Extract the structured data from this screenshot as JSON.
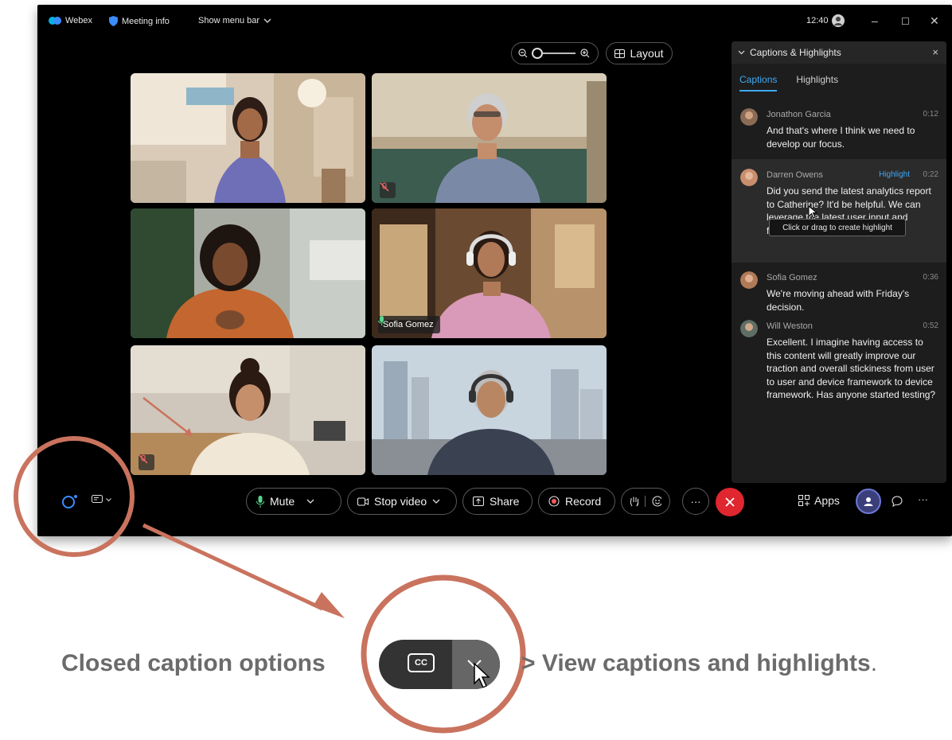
{
  "titlebar": {
    "app": "Webex",
    "meeting_info": "Meeting info",
    "show_menu_bar": "Show menu bar",
    "time": "12:40",
    "minimize": "–",
    "maximize": "☐",
    "close": "✕"
  },
  "toolbar_top": {
    "layout_label": "Layout"
  },
  "participants": [
    {
      "name": "",
      "muted": false
    },
    {
      "name": "",
      "muted": true
    },
    {
      "name": "",
      "muted": false
    },
    {
      "name": "Sofia Gomez",
      "muted": false,
      "active_speaker": true
    },
    {
      "name": "",
      "muted": true
    },
    {
      "name": "",
      "muted": false
    }
  ],
  "captions_panel": {
    "title": "Captions & Highlights",
    "close": "×",
    "tabs": [
      "Captions",
      "Highlights"
    ],
    "active_tab": "Captions",
    "entries": [
      {
        "name": "Jonathon Garcia",
        "time": "0:12",
        "text": "And that's where I think we need to develop our focus."
      },
      {
        "name": "Darren Owens",
        "time": "0:22",
        "badge": "Highlight",
        "text": "Did you send the latest analytics report to Catherine? It'd be helpful. We can leverage the latest user input and feedback"
      },
      {
        "name": "Sofia Gomez",
        "time": "0:36",
        "text": "We're moving ahead with Friday's decision."
      },
      {
        "name": "Will Weston",
        "time": "0:52",
        "text": "Excellent. I imagine having access to this content will greatly improve our traction and overall stickiness from user to user and device framework to device framework. Has anyone started testing?"
      }
    ],
    "tooltip": "Click or drag to create highlight"
  },
  "controls": {
    "mute": "Mute",
    "stop_video": "Stop video",
    "share": "Share",
    "record": "Record",
    "apps": "Apps",
    "more": "···"
  },
  "annotation": {
    "left_text": "Closed caption options",
    "cc_label": "CC",
    "right_text": "> View captions and highlights",
    "period": ".",
    "accent_color": "#c9735e"
  }
}
